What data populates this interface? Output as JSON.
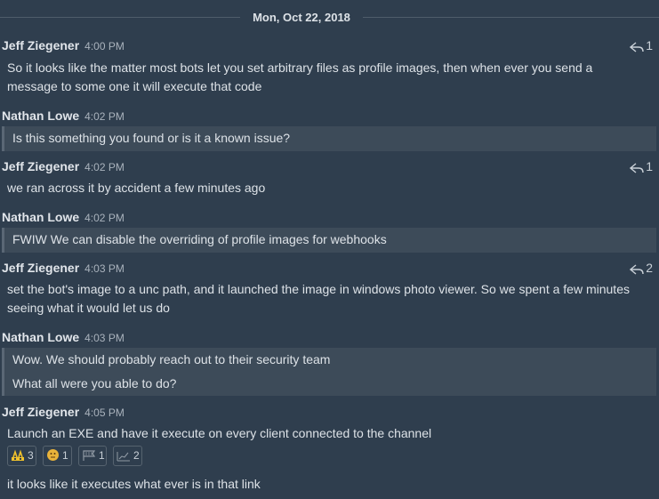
{
  "date_separator": "Mon, Oct 22, 2018",
  "posts": [
    {
      "author": "Jeff Ziegener",
      "time": "4:00 PM",
      "reply_count": "1",
      "lines": [
        "So it looks like the matter most bots let you set arbitrary files as profile images, then when ever you send a",
        "message to some one it will execute that code"
      ]
    },
    {
      "author": "Nathan Lowe",
      "time": "4:02 PM",
      "lines": [
        "Is this something you found or is it a known issue?"
      ]
    },
    {
      "author": "Jeff Ziegener",
      "time": "4:02 PM",
      "reply_count": "1",
      "lines": [
        "we ran across it by accident a few minutes ago"
      ]
    },
    {
      "author": "Nathan Lowe",
      "time": "4:02 PM",
      "lines": [
        "FWIW We can disable the overriding of profile images for webhooks"
      ]
    },
    {
      "author": "Jeff Ziegener",
      "time": "4:03 PM",
      "reply_count": "2",
      "lines": [
        "set the bot's image to a unc path, and it launched the image in windows photo viewer. So we spent a few minutes",
        "seeing what it would let us do"
      ]
    },
    {
      "author": "Nathan Lowe",
      "time": "4:03 PM",
      "lines": [
        "Wow. We should probably reach out to their security team",
        "What all were you able to do?"
      ]
    },
    {
      "author": "Jeff Ziegener",
      "time": "4:05 PM",
      "lines": [
        "Launch an EXE and have it execute on every client connected to the channel"
      ],
      "followup": "it looks like it executes what ever is in that link"
    }
  ],
  "reactions": [
    {
      "icon": "construction-worker-emoji",
      "count": "3"
    },
    {
      "icon": "thinking-face-emoji",
      "count": "1"
    },
    {
      "icon": "flag-emoji",
      "count": "1"
    },
    {
      "icon": "chart-emoji",
      "count": "2"
    }
  ],
  "colors": {
    "background": "#2f3e4e",
    "quote_background": "#3d4b59",
    "text": "#dde2e7",
    "timestamp": "#a9b2bc"
  }
}
